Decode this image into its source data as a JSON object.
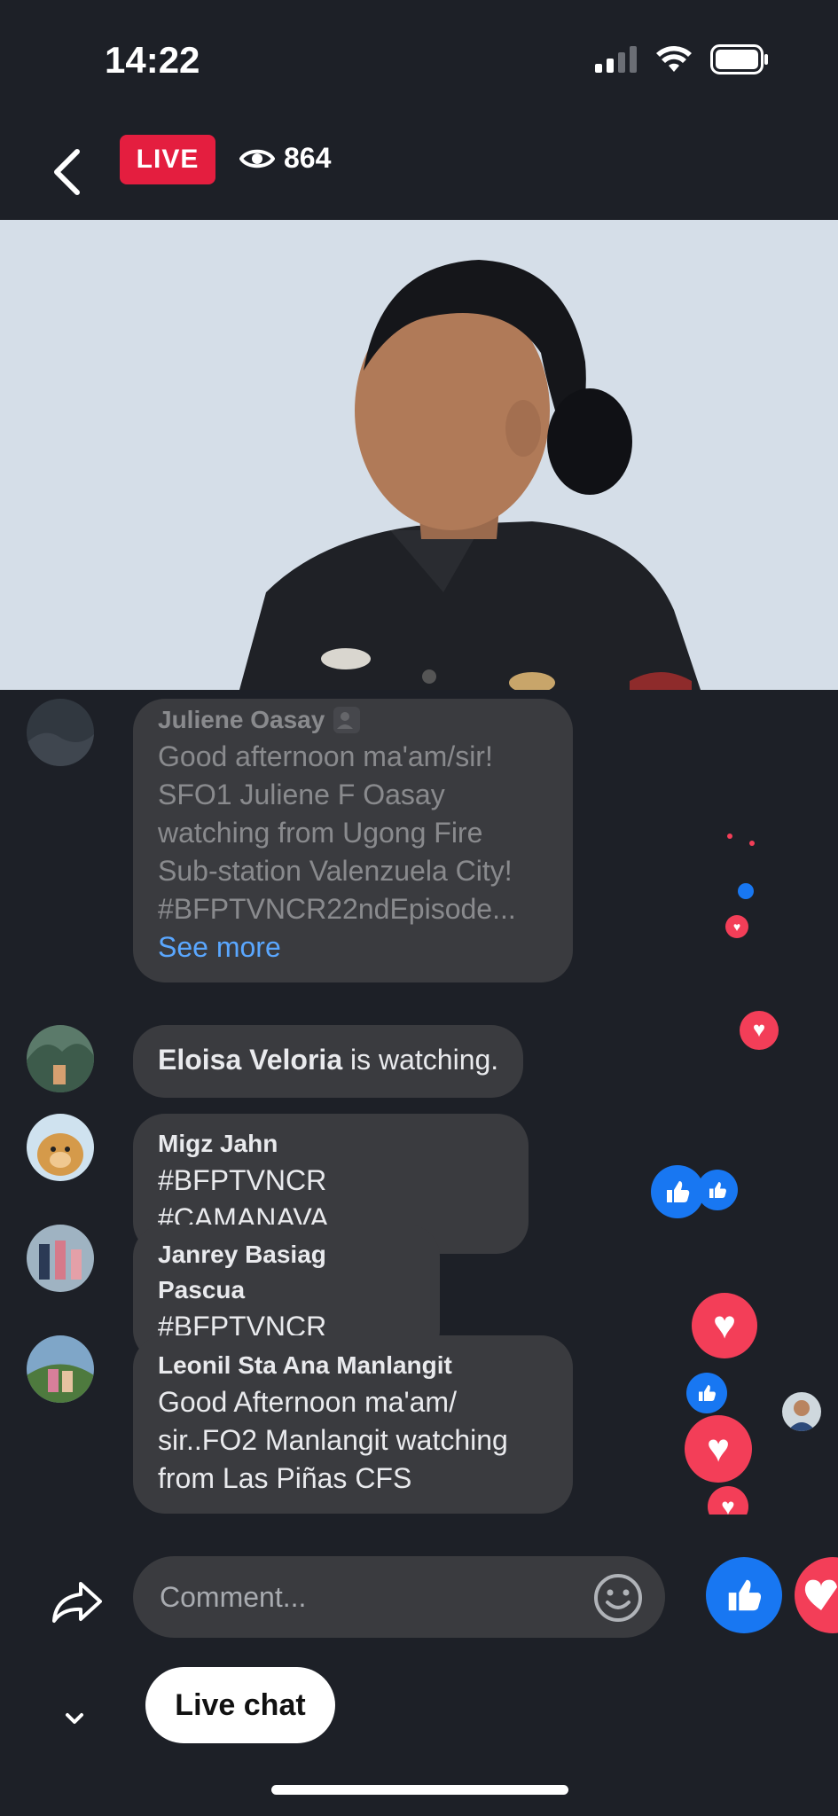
{
  "status_bar": {
    "time": "14:22"
  },
  "header": {
    "live_label": "LIVE",
    "viewer_count": "864"
  },
  "comments": [
    {
      "name": "Juliene Oasay",
      "text": "Good afternoon ma'am/sir! SFO1 Juliene F Oasay watching from Ugong Fire Sub-station Valenzuela City! #BFPTVNCR22ndEpisode...",
      "see_more": "See more"
    },
    {
      "name": "Eloisa Veloria",
      "text": "is watching."
    },
    {
      "name": "Migz Jahn",
      "text": "#BFPTVNCR #CAMANAVA"
    },
    {
      "name": "Janrey Basiag Pascua",
      "text": "#BFPTVNCR"
    },
    {
      "name": "Leonil Sta Ana Manlangit",
      "text": "Good Afternoon ma'am/ sir..FO2 Manlangit watching from Las Piñas CFS"
    }
  ],
  "composer": {
    "placeholder": "Comment...",
    "live_chat_label": "Live chat"
  },
  "colors": {
    "live": "#e41e3f",
    "like": "#1877f2",
    "love": "#f33e58",
    "link": "#5aa7ff",
    "bubble": "#3a3b3f",
    "background": "#1d2027"
  },
  "icons": [
    "back-icon",
    "eye-icon",
    "share-icon",
    "emoji-icon",
    "like-icon",
    "love-icon",
    "chevron-down-icon",
    "signal-icon",
    "wifi-icon",
    "battery-icon"
  ]
}
